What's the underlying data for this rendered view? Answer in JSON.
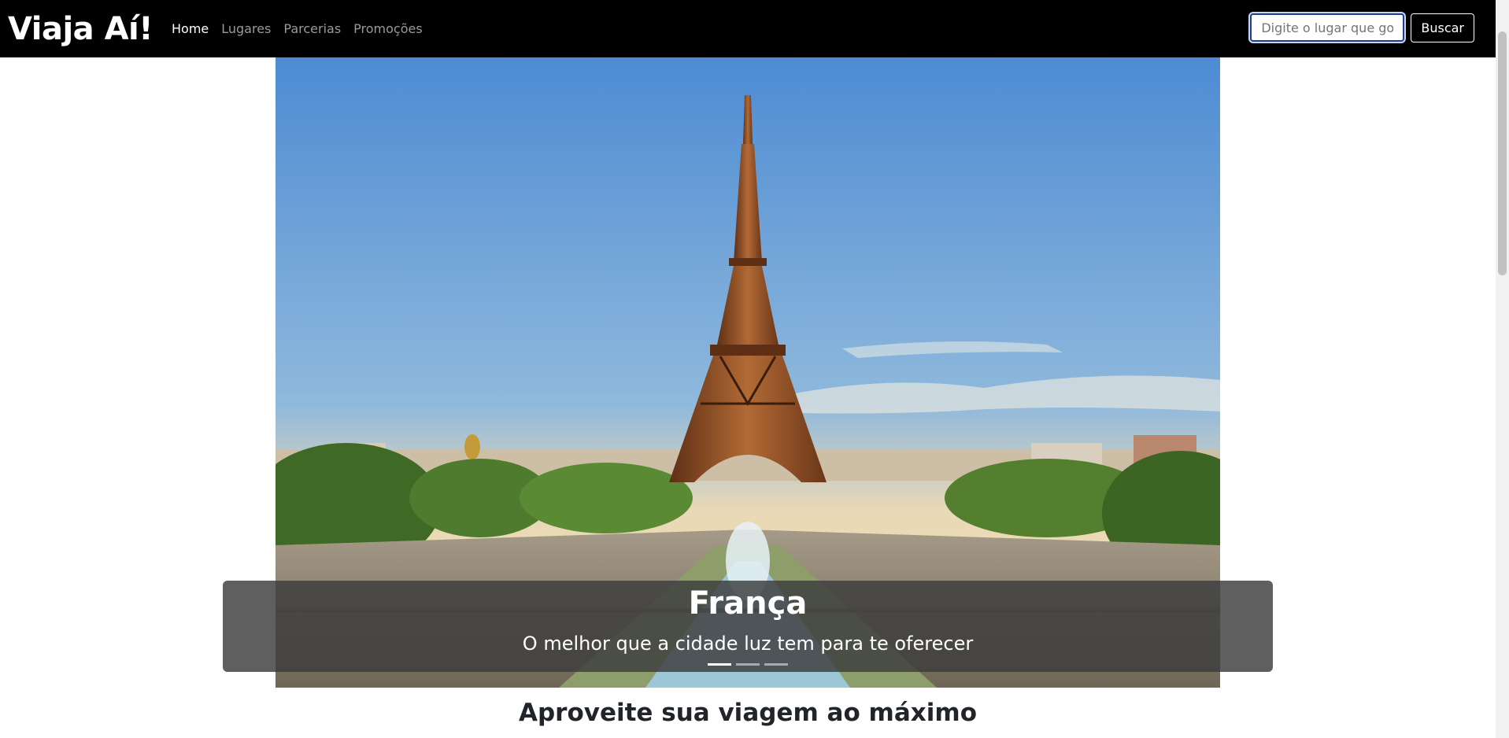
{
  "navbar": {
    "brand": "Viaja Aí!",
    "links": [
      {
        "label": "Home",
        "active": true
      },
      {
        "label": "Lugares",
        "active": false
      },
      {
        "label": "Parcerias",
        "active": false
      },
      {
        "label": "Promoções",
        "active": false
      }
    ],
    "search": {
      "placeholder": "Digite o lugar que gosta",
      "button_label": "Buscar"
    }
  },
  "carousel": {
    "slides_count": 3,
    "active_slide": 1,
    "caption_title": "França",
    "caption_text": "O melhor que a cidade luz tem para te oferecer"
  },
  "section": {
    "title": "Aproveite sua viagem ao máximo"
  },
  "colors": {
    "navbar_bg": "#000000",
    "sky_top": "#4f8fd6",
    "tower": "#8a4a24"
  },
  "icons": []
}
